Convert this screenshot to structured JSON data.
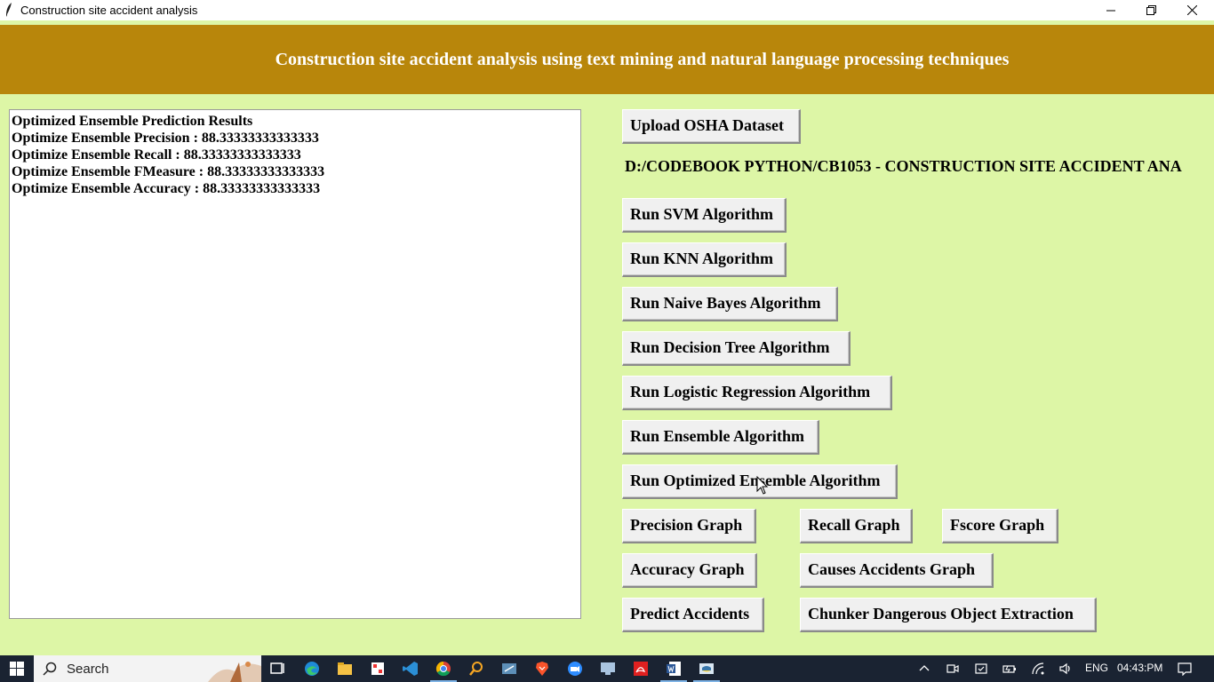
{
  "window": {
    "title": "Construction site accident analysis",
    "minimize_icon": "minimize-icon",
    "maximize_icon": "restore-icon",
    "close_icon": "close-icon"
  },
  "header": {
    "heading": "Construction site accident analysis using text mining and natural language processing techniques",
    "bg_color": "#b8860b"
  },
  "output": {
    "lines": [
      "Optimized Ensemble Prediction Results",
      "Optimize Ensemble Precision : 88.33333333333333",
      "Optimize Ensemble Recall : 88.33333333333333",
      "Optimize Ensemble FMeasure : 88.33333333333333",
      "Optimize Ensemble Accuracy : 88.33333333333333"
    ]
  },
  "buttons": {
    "upload": "Upload OSHA Dataset",
    "svm": "Run SVM Algorithm",
    "knn": "Run KNN Algorithm",
    "naive_bayes": "Run Naive Bayes Algorithm",
    "decision_tree": "Run Decision Tree Algorithm",
    "logistic_regression": "Run Logistic Regression Algorithm",
    "ensemble": "Run Ensemble Algorithm",
    "optimized_ensemble": "Run Optimized Ensemble Algorithm",
    "precision_graph": "Precision Graph",
    "recall_graph": "Recall Graph",
    "fscore_graph": "Fscore Graph",
    "accuracy_graph": "Accuracy Graph",
    "causes_graph": "Causes Accidents Graph",
    "predict": "Predict Accidents",
    "chunker": "Chunker Dangerous Object Extraction"
  },
  "dataset_path": "D:/CODEBOOK PYTHON/CB1053 - CONSTRUCTION SITE ACCIDENT ANA",
  "taskbar": {
    "search_placeholder": "Search",
    "language": "ENG",
    "time": "04:43:PM",
    "pinned_icons": [
      "task-view-icon",
      "edge-icon",
      "file-explorer-icon",
      "app-icon",
      "vscode-icon",
      "chrome-icon",
      "search-app-icon",
      "snipping-tool-icon",
      "brave-icon",
      "zoom-icon",
      "remote-desktop-icon",
      "acrobat-icon",
      "word-icon",
      "python-icon"
    ]
  }
}
